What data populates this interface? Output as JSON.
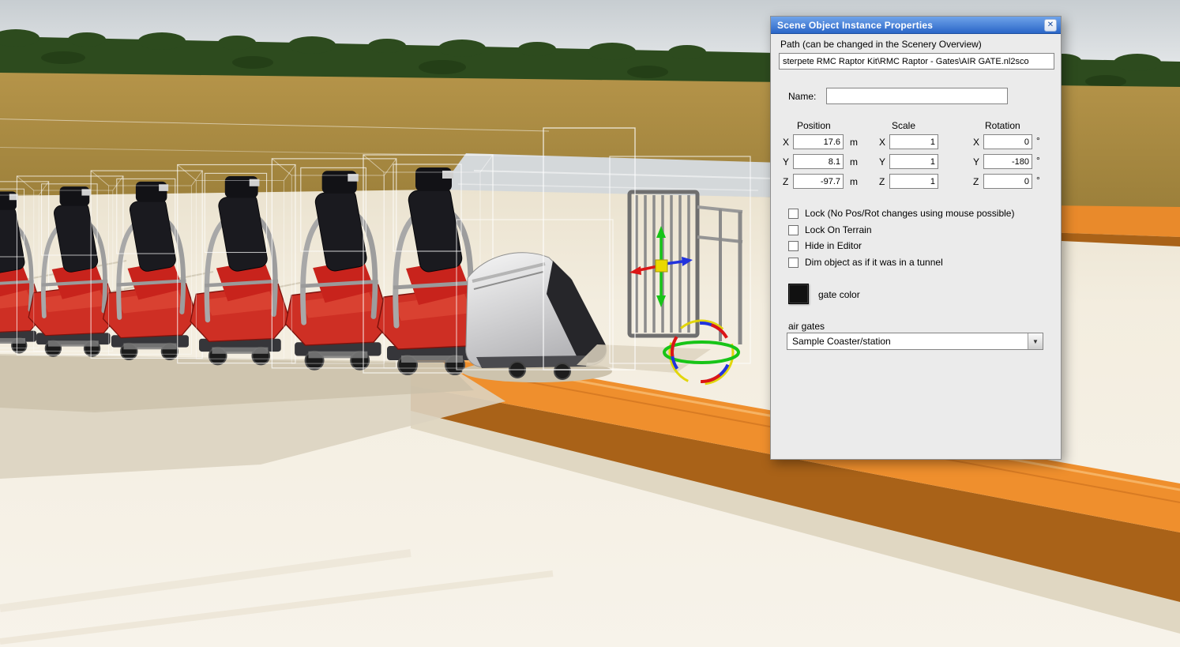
{
  "dialog": {
    "title": "Scene Object Instance Properties",
    "path_label": "Path (can be changed in the Scenery Overview)",
    "path_value": "sterpete RMC Raptor Kit\\RMC Raptor - Gates\\AIR GATE.nl2sco",
    "name_label": "Name:",
    "name_value": "",
    "transform": {
      "position_header": "Position",
      "scale_header": "Scale",
      "rotation_header": "Rotation",
      "rows": [
        {
          "axis": "X",
          "position": "17.6",
          "pos_unit": "m",
          "scale": "1",
          "rotation": "0",
          "rot_unit": "°"
        },
        {
          "axis": "Y",
          "position": "8.1",
          "pos_unit": "m",
          "scale": "1",
          "rotation": "-180",
          "rot_unit": "°"
        },
        {
          "axis": "Z",
          "position": "-97.7",
          "pos_unit": "m",
          "scale": "1",
          "rotation": "0",
          "rot_unit": "°"
        }
      ]
    },
    "checkboxes": [
      {
        "label": "Lock (No Pos/Rot changes using mouse possible)",
        "checked": false
      },
      {
        "label": "Lock On Terrain",
        "checked": false
      },
      {
        "label": "Hide in Editor",
        "checked": false
      },
      {
        "label": "Dim object as if it was in a tunnel",
        "checked": false
      }
    ],
    "gate_color_label": "gate color",
    "gate_color_value": "#111111",
    "air_gates_label": "air gates",
    "air_gates_value": "Sample Coaster/station"
  },
  "icons": {
    "close": "✕",
    "dropdown_arrow": "▼"
  },
  "scene": {
    "colors": {
      "sky": "#dfe3e6",
      "trees": "#2d4b1e",
      "field": "#ab8f45",
      "water": "#d4d8da",
      "platform": "#f3eee1",
      "track_orange": "#ef8f2d",
      "track_shadow": "#a96218",
      "car_red": "#ce2f24",
      "seat_black": "#1a1a1f",
      "wireframe": "#ffffff",
      "gizmo_x": "#dc1616",
      "gizmo_y": "#17c417",
      "gizmo_z": "#2233dd"
    }
  }
}
